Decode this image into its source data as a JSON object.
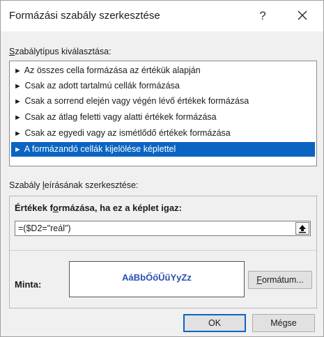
{
  "window": {
    "title": "Formázási szabály szerkesztése",
    "help_label": "?"
  },
  "rule_type": {
    "label_underline": "S",
    "label_rest": "zabálytípus kiválasztása:",
    "items": [
      {
        "label": "Az összes cella formázása az értékük alapján",
        "selected": false
      },
      {
        "label": "Csak az adott tartalmú cellák formázása",
        "selected": false
      },
      {
        "label": "Csak a sorrend elején vagy végén lévő értékek formázása",
        "selected": false
      },
      {
        "label": "Csak az átlag feletti vagy alatti értékek formázása",
        "selected": false
      },
      {
        "label": "Csak az egyedi vagy az ismétlődő értékek formázása",
        "selected": false
      },
      {
        "label": "A formázandó cellák kijelölése képlettel",
        "selected": true
      }
    ],
    "item_icon": "arrow-right-icon"
  },
  "rule_description": {
    "label_pre": "Szabály ",
    "label_underline": "l",
    "label_post": "eírásának szerkesztése:",
    "heading_pre": "Értékek f",
    "heading_underline": "o",
    "heading_post": "rmázása, ha ez a képlet igaz:",
    "formula_value": "=($D2=\"reál\")",
    "collapse_icon": "collapse-dialog-icon",
    "sample_label": "Minta:",
    "sample_text": "AáBbŐőŰűYyZz",
    "format_button_underline": "F",
    "format_button_rest": "ormátum..."
  },
  "footer": {
    "ok_label": "OK",
    "cancel_label": "Mégse"
  },
  "colors": {
    "selection": "#0a64c2",
    "sample_text": "#2a4fb0",
    "dialog_bg": "#f0f0f0"
  }
}
